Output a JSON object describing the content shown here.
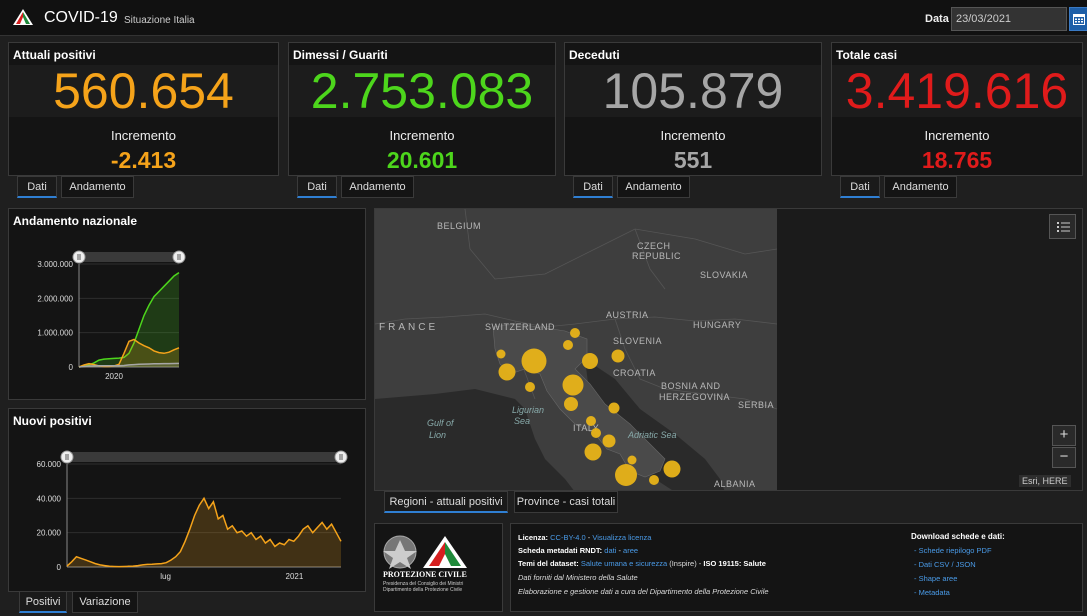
{
  "header": {
    "title": "COVID-19",
    "subtitle": "Situazione Italia",
    "date_label": "Data",
    "date_value": "23/03/2021"
  },
  "cards": [
    {
      "title": "Attuali positivi",
      "value": "560.654",
      "inc_label": "Incremento",
      "inc": "-2.413",
      "color": "#f5a31a",
      "tabs": [
        "Dati",
        "Andamento"
      ]
    },
    {
      "title": "Dimessi / Guariti",
      "value": "2.753.083",
      "inc_label": "Incremento",
      "inc": "20.601",
      "color": "#4dd61c",
      "tabs": [
        "Dati",
        "Andamento"
      ]
    },
    {
      "title": "Deceduti",
      "value": "105.879",
      "inc_label": "Incremento",
      "inc": "551",
      "color": "#a6a6a6",
      "tabs": [
        "Dati",
        "Andamento"
      ]
    },
    {
      "title": "Totale casi",
      "value": "3.419.616",
      "inc_label": "Incremento",
      "inc": "18.765",
      "color": "#e01b1b",
      "tabs": [
        "Dati",
        "Andamento"
      ]
    }
  ],
  "chart_national": {
    "title": "Andamento nazionale",
    "chart_data": {
      "type": "area",
      "y_ticks": [
        "3.000.000",
        "2.000.000",
        "1.000.000",
        "0"
      ],
      "x_ticks": [
        "2020"
      ],
      "ylim": [
        0,
        3000000
      ],
      "series": [
        {
          "color": "#4dd61c",
          "values": [
            0,
            20000,
            60000,
            120000,
            200000,
            230000,
            240000,
            250000,
            260000,
            280000,
            400000,
            700000,
            1100000,
            1500000,
            1800000,
            2050000,
            2200000,
            2350000,
            2500000,
            2650000,
            2750000
          ]
        },
        {
          "color": "#f5a31a",
          "values": [
            0,
            60000,
            100000,
            70000,
            30000,
            15000,
            15000,
            30000,
            80000,
            400000,
            750000,
            800000,
            700000,
            620000,
            560000,
            470000,
            420000,
            400000,
            430000,
            500000,
            560000
          ]
        },
        {
          "color": "#a6a6a6",
          "values": [
            0,
            15000,
            30000,
            33000,
            35000,
            35000,
            35000,
            36000,
            38000,
            45000,
            60000,
            70000,
            80000,
            85000,
            88000,
            92000,
            95000,
            98000,
            100000,
            103000,
            105000
          ]
        }
      ]
    }
  },
  "chart_new": {
    "title": "Nuovi positivi",
    "chart_data": {
      "type": "area",
      "y_ticks": [
        "60.000",
        "40.000",
        "20.000",
        "0"
      ],
      "x_ticks": [
        "lug",
        "2021"
      ],
      "ylim": [
        0,
        60000
      ],
      "series": [
        {
          "color": "#f5a31a",
          "values": [
            500,
            3000,
            6000,
            5000,
            4000,
            3000,
            2000,
            1200,
            800,
            400,
            300,
            250,
            300,
            400,
            500,
            800,
            1200,
            1500,
            1600,
            1800,
            2000,
            2500,
            4000,
            6000,
            9000,
            15000,
            22000,
            30000,
            36000,
            40000,
            34000,
            38000,
            28000,
            30000,
            22000,
            24000,
            20000,
            21000,
            18000,
            20000,
            16000,
            18000,
            14000,
            16000,
            12000,
            14000,
            13000,
            16000,
            15000,
            18000,
            22000,
            24000,
            20000,
            23000,
            26000,
            22000,
            25000,
            20000,
            15000
          ]
        }
      ]
    }
  },
  "tabs_bottom_left": [
    "Positivi",
    "Variazione"
  ],
  "map": {
    "tabs": [
      "Regioni - attuali positivi",
      "Province - casi totali"
    ],
    "attribution": "Esri, HERE",
    "zoom_in": "+",
    "zoom_out": "−",
    "labels": [
      "BELGIUM",
      "CZECH",
      "REPUBLIC",
      "SLOVAKIA",
      "FRANCE",
      "SWITZERLAND",
      "AUSTRIA",
      "HUNGARY",
      "SLOVENIA",
      "CROATIA",
      "BOSNIA AND",
      "HERZEGOVINA",
      "SERBIA",
      "ITALY",
      "ALBANIA",
      "Ligurian",
      "Sea",
      "Gulf of",
      "Lion",
      "Adriatic Sea"
    ],
    "bubble_color": "#e8b318"
  },
  "footer": {
    "logo_text": [
      "PROTEZIONE CIVILE",
      "Presidenza del Consiglio dei Ministri",
      "Dipartimento della Protezione Civile"
    ],
    "licenza_label": "Licenza:",
    "licenza_link1": "CC-BY-4.0",
    "licenza_sep": " - ",
    "licenza_link2": "Visualizza licenza",
    "scheda_label": "Scheda metadati RNDT:",
    "scheda_link1": "dati",
    "scheda_sep": " - ",
    "scheda_link2": "aree",
    "temi_label": "Temi del dataset:",
    "temi_link": "Salute umana e sicurezza",
    "temi_rest": " (Inspire) - ",
    "temi_iso": "ISO 19115: Salute",
    "dati_forniti": "Dati forniti dal Ministero della Salute",
    "elaborazione": "Elaborazione e gestione dati a cura del Dipartimento della Protezione Civile",
    "download_title": "Download schede e dati:",
    "downloads": [
      "- Schede riepilogo PDF",
      "- Dati CSV / JSON",
      "- Shape aree",
      "- Metadata"
    ]
  }
}
